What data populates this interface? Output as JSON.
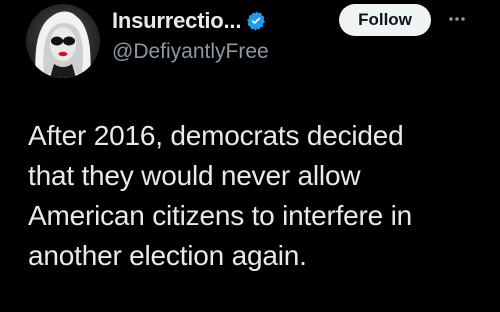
{
  "author": {
    "display_name": "Insurrectio...",
    "handle": "@DefiyantlyFree",
    "verified": true,
    "avatar_icon": "woman-sunglasses-avatar"
  },
  "actions": {
    "follow_label": "Follow",
    "more_icon": "more-dots-icon"
  },
  "tweet": {
    "text": "After 2016, democrats decided\nthat they would never allow\nAmerican citizens to interfere in\nanother election again."
  },
  "colors": {
    "background": "#000000",
    "text_primary": "#e7e9ea",
    "text_secondary": "#8b98a5",
    "verified_blue": "#1d9bf0",
    "follow_bg": "#eff3f4",
    "follow_text": "#0f1419"
  }
}
